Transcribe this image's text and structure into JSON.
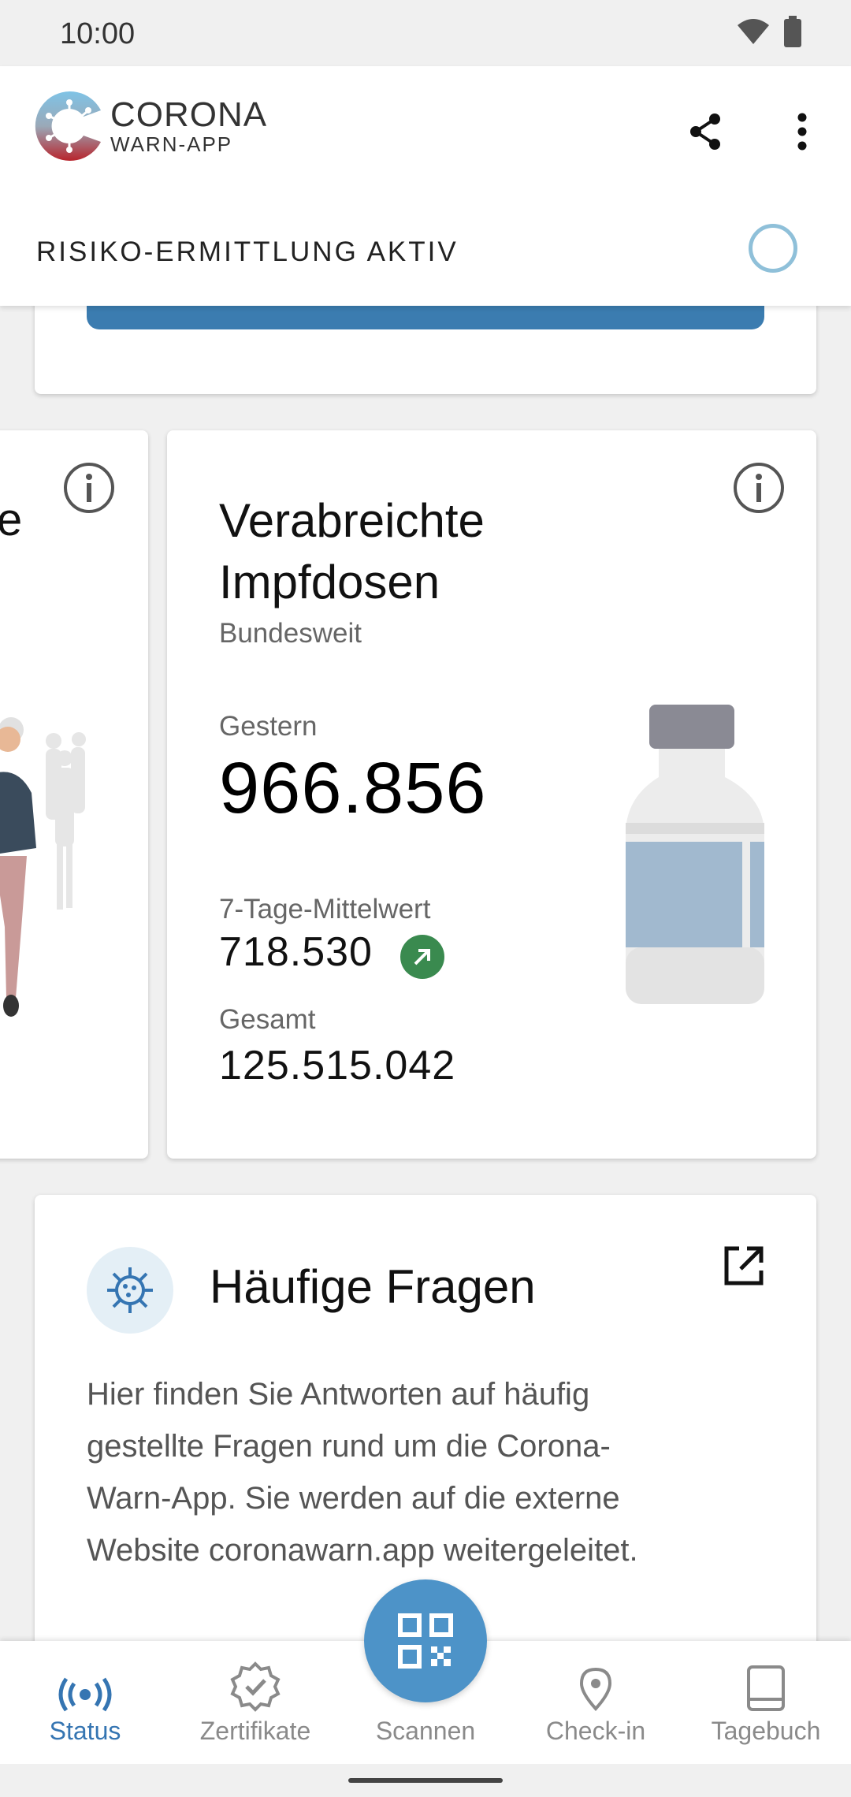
{
  "status_bar": {
    "time": "10:00"
  },
  "header": {
    "logo_line1": "CORONA",
    "logo_line2": "WARN-APP",
    "risk_status": "RISIKO-ERMITTLUNG AKTIV"
  },
  "stats_left_card": {
    "title_fragment": "e"
  },
  "stats_card": {
    "title": "Verabreichte Impfdosen",
    "subtitle": "Bundesweit",
    "yesterday_label": "Gestern",
    "yesterday_value": "966.856",
    "avg_label": "7-Tage-Mittelwert",
    "avg_value": "718.530",
    "avg_trend": "up",
    "total_label": "Gesamt",
    "total_value": "125.515.042"
  },
  "faq": {
    "title": "Häufige Fragen",
    "body": "Hier finden Sie Antworten auf häufig gestellte Fragen rund um die Corona-Warn-App. Sie werden auf die externe Website coronawarn.app weitergeleitet."
  },
  "bottom_nav": {
    "items": [
      {
        "label": "Status",
        "icon": "broadcast-icon",
        "active": true
      },
      {
        "label": "Zertifikate",
        "icon": "certificate-icon",
        "active": false
      },
      {
        "label": "Scannen",
        "icon": "qr-code-icon",
        "active": false
      },
      {
        "label": "Check-in",
        "icon": "location-pin-icon",
        "active": false
      },
      {
        "label": "Tagebuch",
        "icon": "book-icon",
        "active": false
      }
    ]
  },
  "colors": {
    "brand_blue": "#3575b2",
    "fab_blue": "#4d93c8",
    "trend_green": "#3a8a4f",
    "risk_circle": "#8fc0d9"
  }
}
